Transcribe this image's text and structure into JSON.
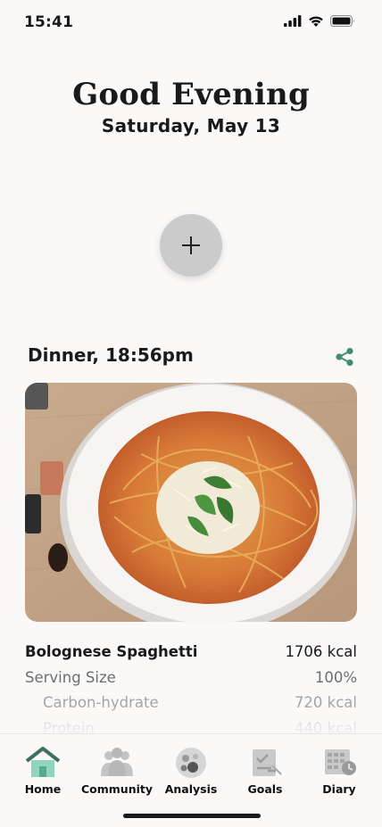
{
  "status": {
    "time": "15:41",
    "icons": [
      "cellular-signal-icon",
      "wifi-icon",
      "battery-icon"
    ]
  },
  "header": {
    "greeting": "Good Evening",
    "date": "Saturday, May 13"
  },
  "add_button": {
    "icon": "plus-icon"
  },
  "meal": {
    "title": "Dinner, 18:56pm",
    "share_icon": "share-icon",
    "photo": "spaghetti-bolognese-plate"
  },
  "nutrition": {
    "dish": {
      "label": "Bolognese Spaghetti",
      "value": "1706 kcal"
    },
    "serving": {
      "label": "Serving Size",
      "value": "100%"
    },
    "carbs": {
      "label": "Carbon-hydrate",
      "value": "720 kcal"
    },
    "protein": {
      "label": "Protein",
      "value": "440 kcal"
    }
  },
  "tabs": [
    {
      "label": "Home",
      "icon": "home-icon",
      "active": true
    },
    {
      "label": "Community",
      "icon": "community-icon",
      "active": false
    },
    {
      "label": "Analysis",
      "icon": "analysis-icon",
      "active": false
    },
    {
      "label": "Goals",
      "icon": "goals-icon",
      "active": false
    },
    {
      "label": "Diary",
      "icon": "diary-icon",
      "active": false
    }
  ],
  "colors": {
    "background": "#fbf8f8",
    "accent_green": "#3e8f72",
    "home_active": "#8fd4be",
    "inactive_icon": "#c4c4c4"
  }
}
